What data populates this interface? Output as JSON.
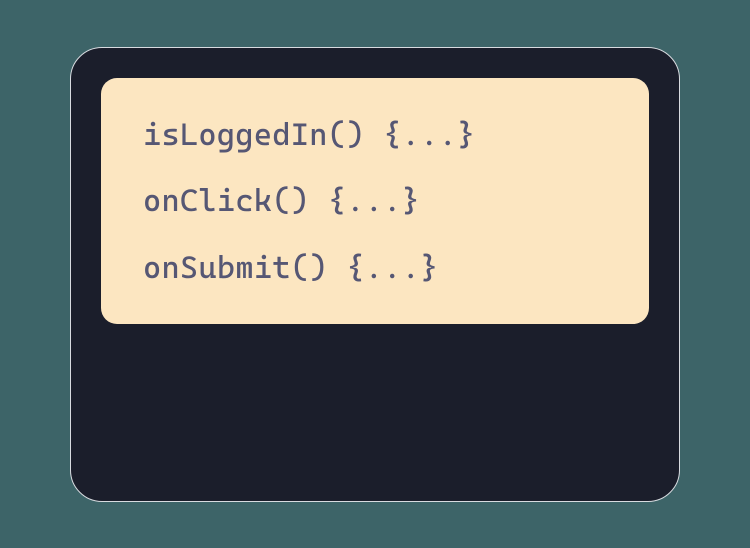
{
  "code": {
    "lines": [
      "isLoggedIn() {...}",
      "onClick() {...}",
      "onSubmit() {...}"
    ]
  }
}
